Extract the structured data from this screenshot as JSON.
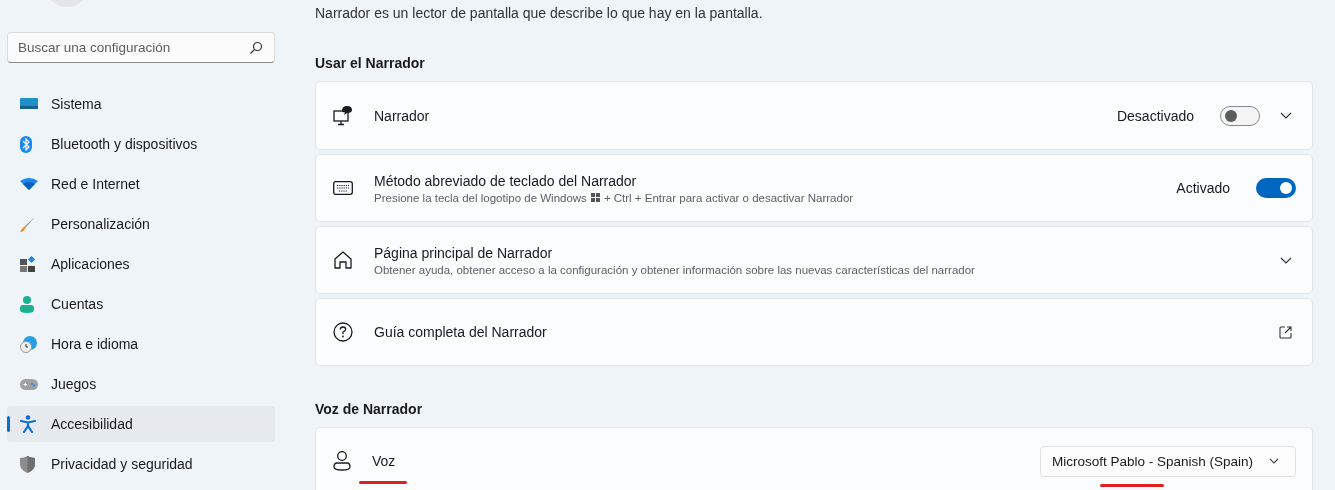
{
  "search": {
    "placeholder": "Buscar una configuración"
  },
  "sidebar": {
    "items": [
      {
        "label": "Sistema",
        "selected": false
      },
      {
        "label": "Bluetooth y dispositivos",
        "selected": false
      },
      {
        "label": "Red e Internet",
        "selected": false
      },
      {
        "label": "Personalización",
        "selected": false
      },
      {
        "label": "Aplicaciones",
        "selected": false
      },
      {
        "label": "Cuentas",
        "selected": false
      },
      {
        "label": "Hora e idioma",
        "selected": false
      },
      {
        "label": "Juegos",
        "selected": false
      },
      {
        "label": "Accesibilidad",
        "selected": true
      },
      {
        "label": "Privacidad y seguridad",
        "selected": false
      }
    ]
  },
  "description": "Narrador es un lector de pantalla que describe lo que hay en la pantalla.",
  "sections": [
    {
      "heading": "Usar el Narrador",
      "cards": [
        {
          "kind": "toggle-expand",
          "title": "Narrador",
          "state_label": "Desactivado",
          "on": false
        },
        {
          "kind": "toggle",
          "title": "Método abreviado de teclado del Narrador",
          "subtitle_parts": [
            "Presione la tecla del logotipo de Windows",
            "+ Ctrl + Entrar para activar o desactivar Narrador"
          ],
          "state_label": "Activado",
          "on": true
        },
        {
          "kind": "expand",
          "title": "Página principal de Narrador",
          "subtitle": "Obtener ayuda, obtener acceso a la configuración y obtener información sobre las nuevas características del narrador"
        },
        {
          "kind": "link",
          "title": "Guía completa del Narrador"
        }
      ]
    },
    {
      "heading": "Voz de Narrador",
      "cards": [
        {
          "kind": "dropdown",
          "title": "Voz",
          "value": "Microsoft Pablo - Spanish (Spain)",
          "underlined": true
        }
      ]
    }
  ]
}
